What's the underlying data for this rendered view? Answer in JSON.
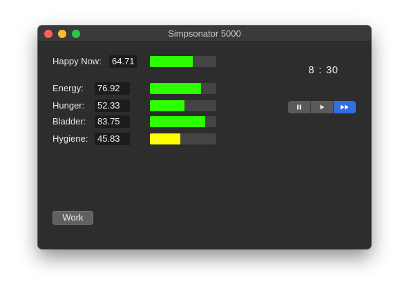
{
  "window": {
    "title": "Simpsonator 5000"
  },
  "stats": {
    "happy": {
      "label": "Happy Now:",
      "value": "64.71",
      "level": 0.6471,
      "color": "#2bff00"
    },
    "needs": [
      {
        "label": "Energy:",
        "value": "76.92",
        "level": 0.7692,
        "color": "#2bff00"
      },
      {
        "label": "Hunger:",
        "value": "52.33",
        "level": 0.5233,
        "color": "#2bff00"
      },
      {
        "label": "Bladder:",
        "value": "83.75",
        "level": 0.8375,
        "color": "#2bff00"
      },
      {
        "label": "Hygiene:",
        "value": "45.83",
        "level": 0.4583,
        "color": "#ffff00"
      }
    ]
  },
  "clock": {
    "hours": "8",
    "separator": ":",
    "minutes": "30"
  },
  "speed_control": {
    "segments": [
      {
        "icon": "pause-icon",
        "selected": false
      },
      {
        "icon": "play-icon",
        "selected": false
      },
      {
        "icon": "fast-forward-icon",
        "selected": true
      }
    ],
    "accent": "#2f6fe0"
  },
  "actions": {
    "work_label": "Work"
  }
}
